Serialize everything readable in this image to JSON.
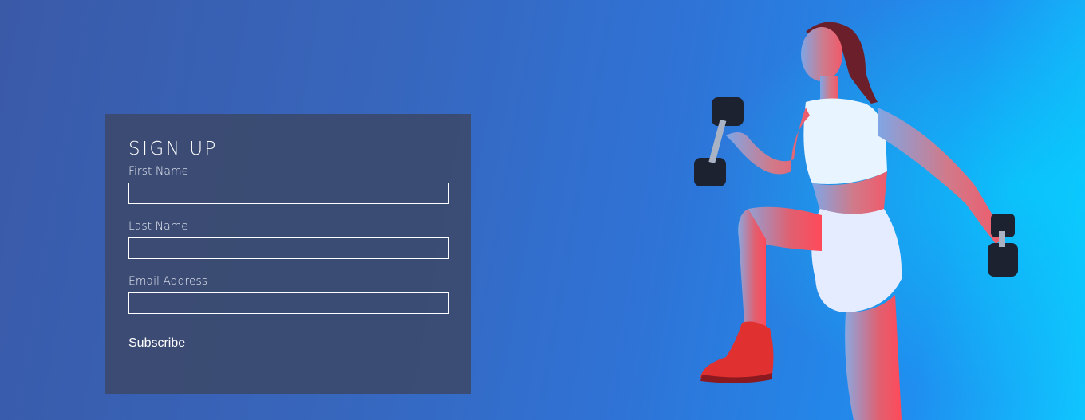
{
  "signup": {
    "title": "SIGN UP",
    "fields": [
      {
        "label": "First Name",
        "value": "",
        "placeholder": ""
      },
      {
        "label": "Last Name",
        "value": "",
        "placeholder": ""
      },
      {
        "label": "Email Address",
        "value": "",
        "placeholder": ""
      }
    ],
    "submit_label": "Subscribe"
  },
  "hero": {
    "image": "athlete-with-dumbbells",
    "colors": {
      "background_left": "#3a5aa8",
      "background_right": "#0fc6ff",
      "panel": "#3c4a6e",
      "sneakers": "#e0302f"
    }
  }
}
